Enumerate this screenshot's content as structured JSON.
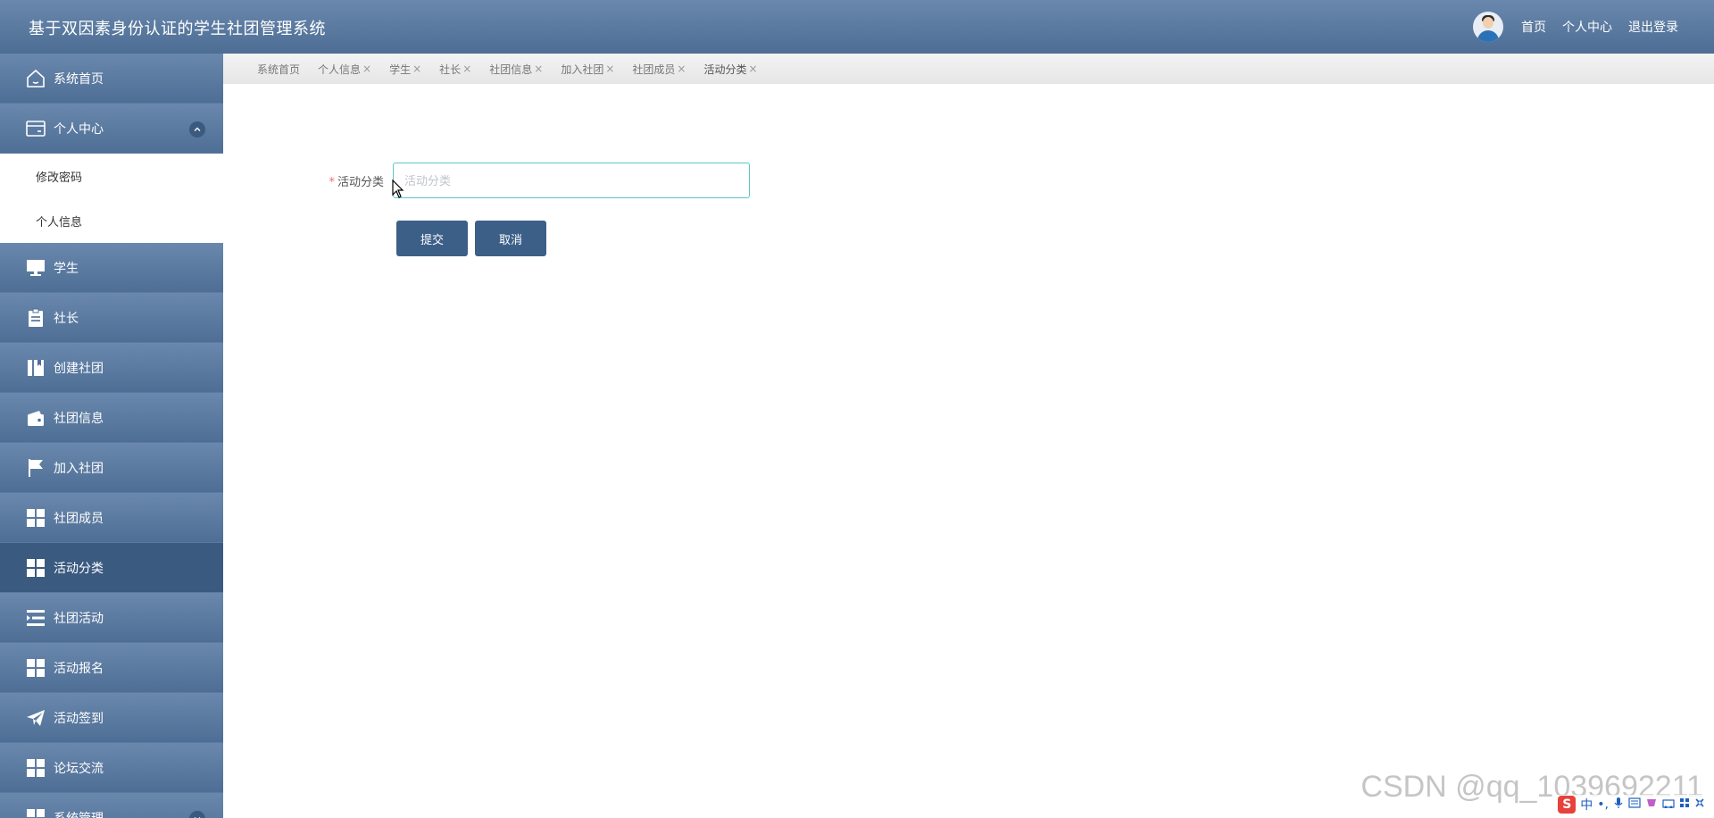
{
  "header": {
    "title": "基于双因素身份认证的学生社团管理系统",
    "links": [
      "首页",
      "个人中心",
      "退出登录"
    ]
  },
  "sidebar": {
    "items": [
      {
        "label": "系统首页",
        "icon": "home-icon"
      },
      {
        "label": "个人中心",
        "icon": "card-icon",
        "expanded": true,
        "children": [
          "修改密码",
          "个人信息"
        ]
      },
      {
        "label": "学生",
        "icon": "monitor-icon"
      },
      {
        "label": "社长",
        "icon": "clipboard-icon"
      },
      {
        "label": "创建社团",
        "icon": "book-icon"
      },
      {
        "label": "社团信息",
        "icon": "wallet-icon"
      },
      {
        "label": "加入社团",
        "icon": "flag-icon"
      },
      {
        "label": "社团成员",
        "icon": "grid-icon"
      },
      {
        "label": "活动分类",
        "icon": "grid-icon",
        "active": true
      },
      {
        "label": "社团活动",
        "icon": "list-icon"
      },
      {
        "label": "活动报名",
        "icon": "grid-icon"
      },
      {
        "label": "活动签到",
        "icon": "send-icon"
      },
      {
        "label": "论坛交流",
        "icon": "grid-icon"
      },
      {
        "label": "系统管理",
        "icon": "grid-icon"
      }
    ]
  },
  "tabs": [
    {
      "label": "系统首页",
      "closable": false
    },
    {
      "label": "个人信息",
      "closable": true
    },
    {
      "label": "学生",
      "closable": true
    },
    {
      "label": "社长",
      "closable": true
    },
    {
      "label": "社团信息",
      "closable": true
    },
    {
      "label": "加入社团",
      "closable": true
    },
    {
      "label": "社团成员",
      "closable": true
    },
    {
      "label": "活动分类",
      "closable": true,
      "current": true
    }
  ],
  "tab_close_glyph": "×",
  "form": {
    "required_mark": "*",
    "category_label": "活动分类",
    "category_placeholder": "活动分类",
    "category_value": "",
    "submit_label": "提交",
    "cancel_label": "取消"
  },
  "watermark": "CSDN @qq_1039692211",
  "ime": {
    "logo": "S",
    "mode": "中"
  },
  "colors": {
    "header": "#5a7aa0",
    "active_nav": "#3a5a80",
    "button": "#3c5f88",
    "input_border": "#5ec3c9",
    "required": "#f56c6c"
  }
}
